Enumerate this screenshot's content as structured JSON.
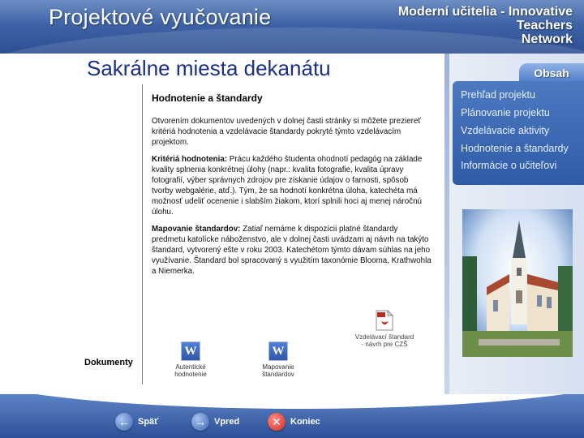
{
  "header": {
    "title": "Projektové vyučovanie",
    "network_lines": [
      "Moderní učitelia - Innovative",
      "Teachers",
      "Network"
    ]
  },
  "page_title": "Sakrálne miesta dekanátu",
  "nav": {
    "tab_label": "Obsah",
    "items": [
      {
        "label": "Prehľad projektu"
      },
      {
        "label": "Plánovanie projektu"
      },
      {
        "label": "Vzdelávacie aktivity"
      },
      {
        "label": "Hodnotenie a štandardy"
      },
      {
        "label": "Informácie o učiteľovi"
      }
    ]
  },
  "content": {
    "heading": "Hodnotenie a štandardy",
    "intro": "Otvorením dokumentov uvedených v dolnej časti stránky si môžete preziereť kritériá hodnotenia a vzdelávacie štandardy pokryté týmto vzdelávacím projektom.",
    "criteria_label": "Kritériá hodnotenia:",
    "criteria_text": " Prácu každého študenta ohodnotí pedagóg na základe kvality splnenia konkrétnej úlohy (napr.: kvalita fotografie, kvalita úpravy fotografií, výber správnych zdrojov pre získanie údajov o farnosti, spôsob tvorby webgalérie, atď.). Tým, že sa hodnotí konkrétna úloha, katechéta má možnosť udeliť ocenenie i slabším žiakom, ktorí splnili hoci aj menej náročnú úlohu.",
    "mapping_label": "Mapovanie štandardov:",
    "mapping_text": " Zatiaľ nemáme k dispozícii platné štandardy predmetu katolícke náboženstvo, ale v dolnej časti uvádzam aj návrh na takýto štandard, vytvorený ešte v roku 2003. Katechétom týmto dávam súhlas na jeho využívanie. Štandard bol spracovaný s využitím taxonómie Blooma, Krathwohla a Niemerka."
  },
  "documents": {
    "label": "Dokumenty",
    "items": [
      {
        "icon": "word-document-icon",
        "label_lines": [
          "Autentické",
          "hodnotenie"
        ]
      },
      {
        "icon": "word-document-icon",
        "label_lines": [
          "Mapovanie",
          "štandardov"
        ]
      },
      {
        "icon": "pdf-document-icon",
        "label_lines": [
          "Vzdelávací štandard",
          "- návrh pre CZŠ"
        ]
      }
    ]
  },
  "footer": {
    "back_label": "Späť",
    "next_label": "Vpred",
    "end_label": "Koniec"
  },
  "colors": {
    "header_blue": "#3e63a6",
    "title_blue": "#1a2f86",
    "nav_blue": "#2f5aa7",
    "end_red": "#d12a1f"
  }
}
